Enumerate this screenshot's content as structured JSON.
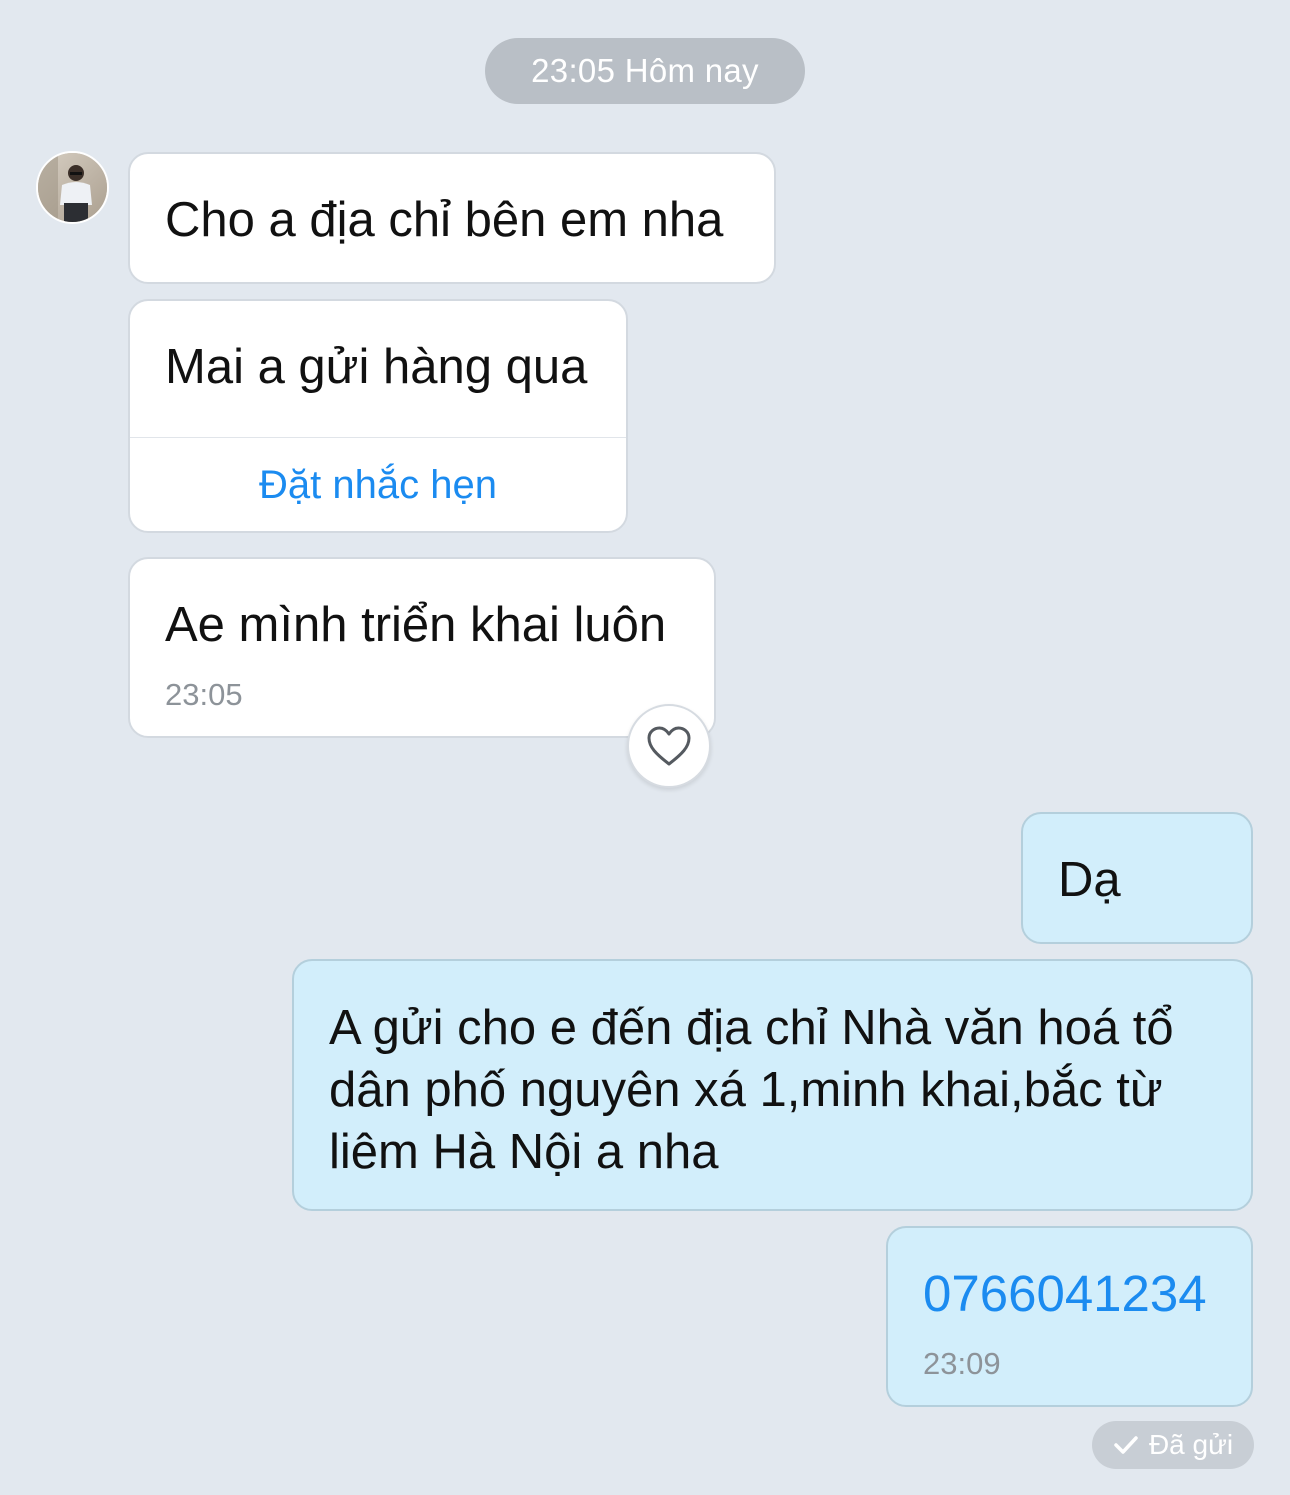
{
  "header": {
    "date_label": "23:05 Hôm nay"
  },
  "colors": {
    "background": "#e2e8ef",
    "incoming_bubble": "#ffffff",
    "outgoing_bubble": "#d2eefb",
    "link": "#1b8bf0"
  },
  "incoming": {
    "avatar_icon": "user-avatar",
    "messages": [
      {
        "text": "Cho a địa chỉ bên em nha"
      },
      {
        "text": "Mai a gửi hàng qua",
        "action_label": "Đặt nhắc hẹn"
      },
      {
        "text": "Ae mình triển khai luôn",
        "time": "23:05",
        "reaction_icon": "heart-outline-icon"
      }
    ]
  },
  "outgoing": {
    "messages": [
      {
        "text": "Dạ"
      },
      {
        "text": "A gửi cho e đến địa chỉ Nhà văn hoá tổ dân phố nguyên xá 1,minh khai,bắc từ liêm Hà Nội a nha"
      },
      {
        "text": "0766041234",
        "time": "23:09"
      }
    ],
    "status_icon": "checkmark-icon",
    "status_label": "Đã gửi"
  }
}
